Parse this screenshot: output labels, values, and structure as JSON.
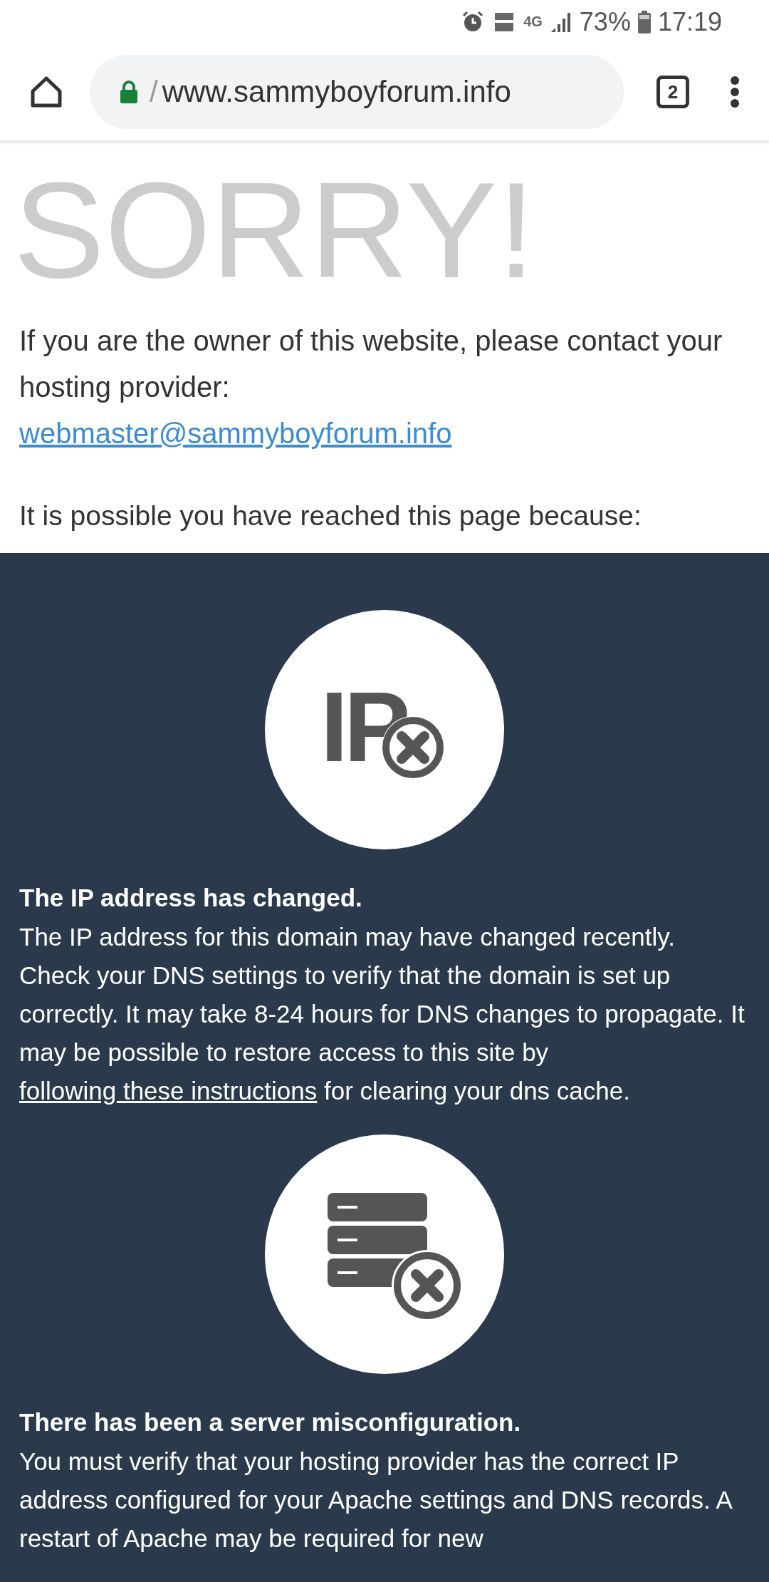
{
  "status_bar": {
    "battery": "73%",
    "time": "17:19",
    "network": "4G"
  },
  "toolbar": {
    "url_prefix": "/",
    "url": "www.sammyboyforum.info",
    "tab_count": "2"
  },
  "page": {
    "title": "SORRY!",
    "owner_text": "If you are the owner of this website, please contact your hosting provider:",
    "email_link": "webmaster@sammyboyforum.info",
    "reason_intro": "It is possible you have reached this page because:",
    "reasons": [
      {
        "kind": "ip",
        "icon_label": "IP",
        "heading": "The IP address has changed.",
        "text_before": "The IP address for this domain may have changed recently. Check your DNS settings to verify that the domain is set up correctly. It may take 8-24 hours for DNS changes to propagate. It may be possible to restore access to this site by",
        "link": "following these instructions",
        "text_after": "for clearing your dns cache."
      },
      {
        "kind": "server",
        "heading": "There has been a server misconfiguration.",
        "text_before": "You must verify that your hosting provider has the correct IP address configured for your Apache settings and DNS records. A restart of Apache may be required for new"
      }
    ]
  }
}
